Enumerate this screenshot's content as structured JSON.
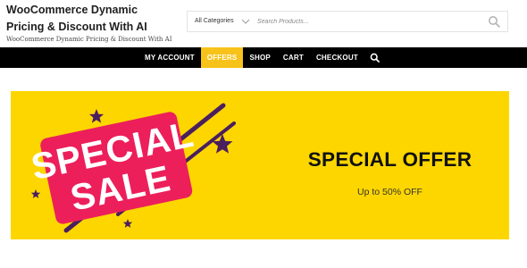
{
  "site": {
    "title": "WooCommerce Dynamic Pricing & Discount With AI",
    "tagline": "WooCommerce Dynamic Pricing & Discount With AI"
  },
  "search": {
    "category": "All Categories",
    "placeholder": "Search Products..."
  },
  "nav": {
    "items": [
      {
        "label": "MY ACCOUNT",
        "active": false
      },
      {
        "label": "OFFERS",
        "active": true
      },
      {
        "label": "SHOP",
        "active": false
      },
      {
        "label": "CART",
        "active": false
      },
      {
        "label": "CHECKOUT",
        "active": false
      }
    ]
  },
  "banner": {
    "graphic_line1": "SPECIAL",
    "graphic_line2": "SALE",
    "title": "SPECIAL OFFER",
    "subtitle": "Up to 50% OFF"
  },
  "colors": {
    "nav_background": "#000000",
    "nav_active": "#f7c21a",
    "banner_background": "#fdd600",
    "sale_tag": "#ec1f5b",
    "star": "#4a1f5e"
  },
  "icons": {
    "search": "search-icon",
    "dropdown": "chevron-down-icon",
    "decor": "star-icon"
  }
}
